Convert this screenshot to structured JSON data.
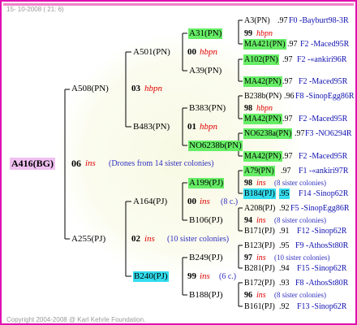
{
  "header": {
    "stamp": "15- 10-2008 ( 21:  6)"
  },
  "footer": {
    "copyright": "Copyright 2004-2008 @ Karl Kehrle Foundation."
  },
  "root": {
    "id": "A416(BG)",
    "num": "06",
    "sym": "ins",
    "note": "(Drones from 14 sister colonies)"
  },
  "g1": [
    {
      "id": "A508(PN)",
      "num": "03",
      "sym": "hbpn"
    },
    {
      "id": "A255(PJ)",
      "num": "02",
      "sym": "ins",
      "note": "(10 sister colonies)"
    }
  ],
  "g2": [
    {
      "id": "A501(PN)",
      "num": "00",
      "sym": "hbpn"
    },
    {
      "id": "B483(PN)",
      "num": "01",
      "sym": "hbpn"
    },
    {
      "id": "A164(PJ)",
      "num": "00",
      "sym": "ins",
      "note": "(8 c.)"
    },
    {
      "id": "B240(PJ)",
      "num": "99",
      "sym": "ins",
      "note": "(6 c.)"
    }
  ],
  "g3": [
    {
      "id": "A31(PN)",
      "num": "99",
      "sym": "hbpn"
    },
    {
      "id": "A39(PN)"
    },
    {
      "id": "B383(PN)",
      "num": "98",
      "sym": "hbpn"
    },
    {
      "id": "NO6238b(PN)"
    },
    {
      "id": "A199(PJ)",
      "num": "98",
      "sym": "ins",
      "note": "(8 sister colonies)"
    },
    {
      "id": "B106(PJ)",
      "num": "94",
      "sym": "ins",
      "note": "(8 sister colonies)"
    },
    {
      "id": "B249(PJ)",
      "num": "97",
      "sym": "ins",
      "note": "(10 sister colonies)"
    },
    {
      "id": "B188(PJ)",
      "num": "96",
      "sym": "ins",
      "note": "(8 sister colonies)"
    }
  ],
  "g4": [
    {
      "id": "A3(PN)",
      "yr": ".97",
      "ref": "F0 -Bayburt98-3R"
    },
    {
      "id": "MA421(PN)",
      "yr": ".97",
      "ref": "F2 -Maced95R"
    },
    {
      "id": "A102(PN)",
      "yr": ".97",
      "ref": "F2 -«ankiri96R"
    },
    {
      "id": "MA42(PN)",
      "yr": ".97",
      "ref": "F2 -Maced95R"
    },
    {
      "id": "B238b(PN)",
      "yr": ".96",
      "ref": "F8 -SinopEgg86R"
    },
    {
      "id": "MA42(PN)",
      "yr": ".97",
      "ref": "F2 -Maced95R"
    },
    {
      "id": "NO6238a(PN)",
      "yr": ".97",
      "ref": "F3 -NO6294R"
    },
    {
      "id": "MA42(PN)",
      "yr": ".97",
      "ref": "F2 -Maced95R"
    },
    {
      "id": "A79(PN)",
      "yr": ".97",
      "ref": "F1 -«ankiri97R"
    },
    {
      "id": "B184(PJ)",
      "yr": ".95",
      "ref": "F14 -Sinop62R"
    },
    {
      "id": "A208(PJ)",
      "yr": ".92",
      "ref": "F5 -SinopEgg86R"
    },
    {
      "id": "B171(PJ)",
      "yr": ".91",
      "ref": "F12 -Sinop62R"
    },
    {
      "id": "B123(PJ)",
      "yr": ".95",
      "ref": "F9 -AthosSt80R"
    },
    {
      "id": "B281(PJ)",
      "yr": ".94",
      "ref": "F15 -Sinop62R"
    },
    {
      "id": "B172(PJ)",
      "yr": ".93",
      "ref": "F8 -AthosSt80R"
    },
    {
      "id": "B161(PJ)",
      "yr": ".92",
      "ref": "F13 -Sinop62R"
    }
  ]
}
